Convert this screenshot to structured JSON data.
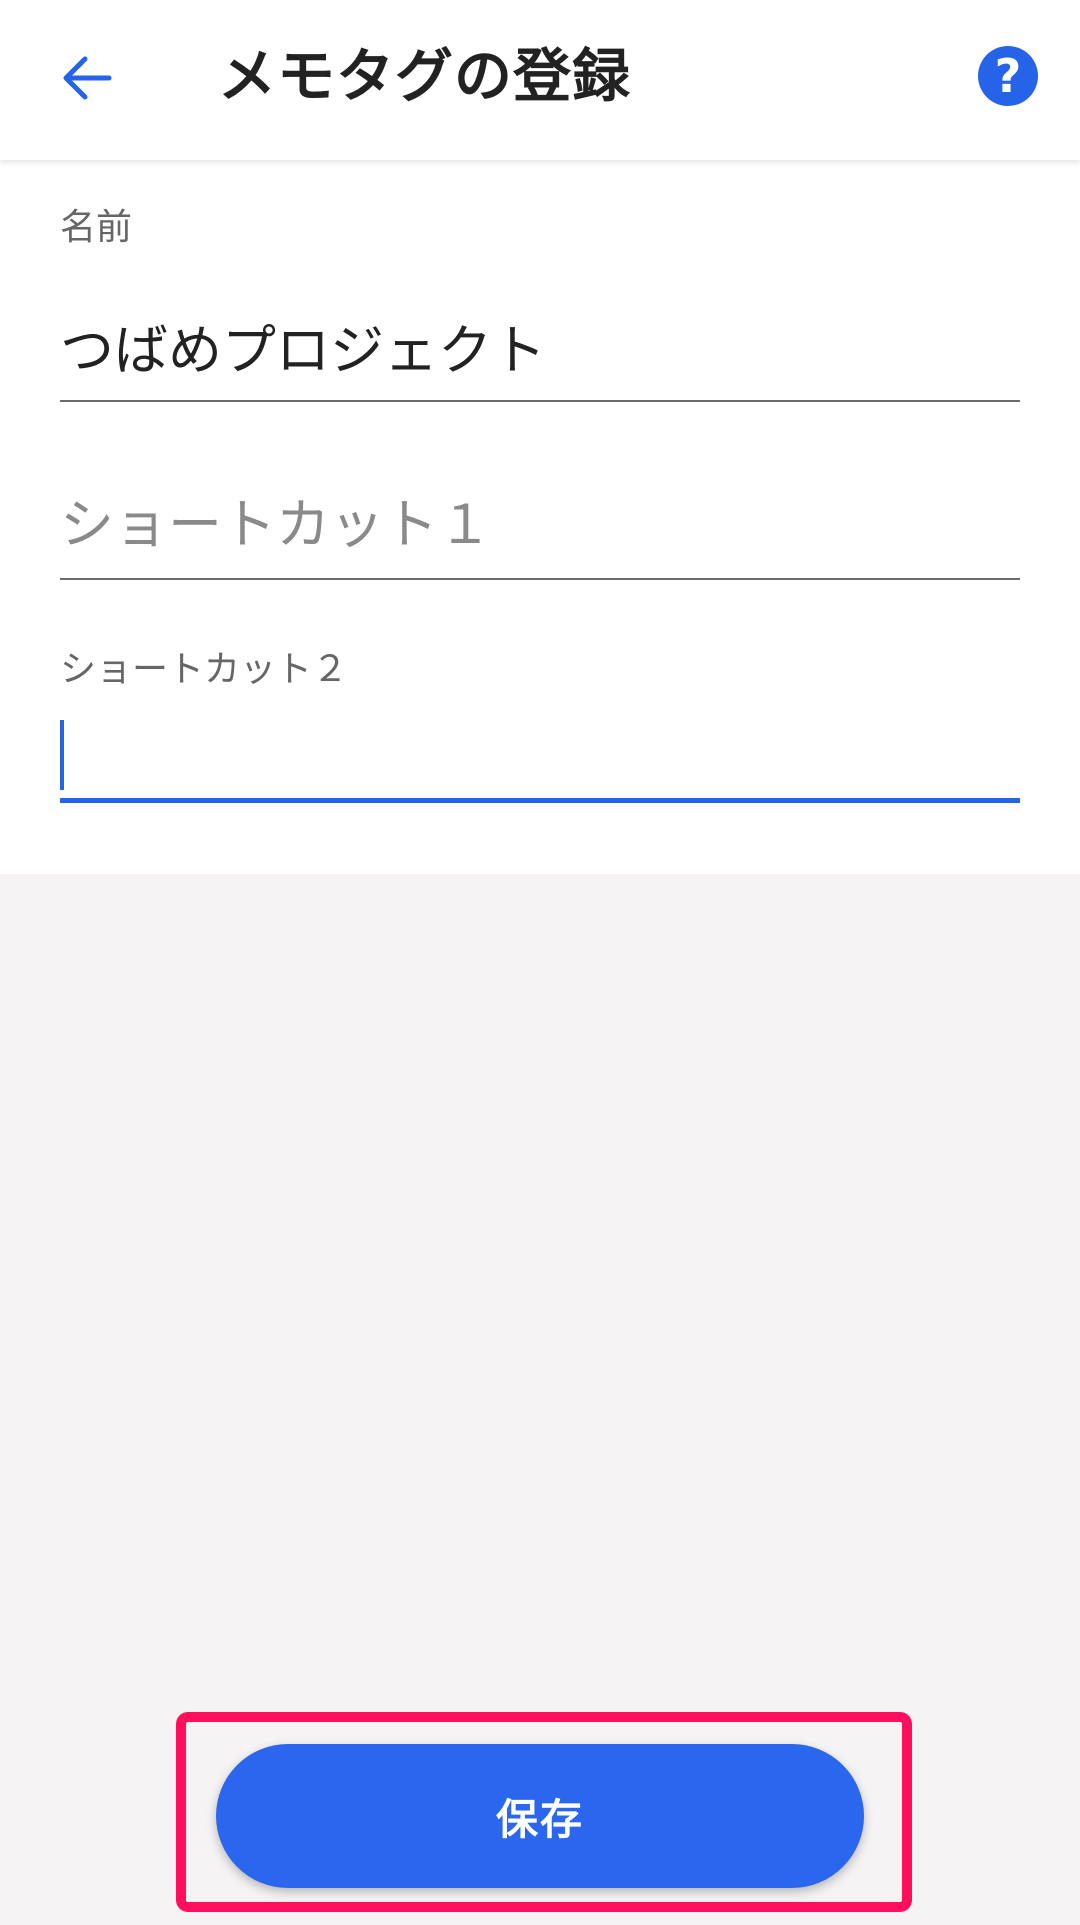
{
  "header": {
    "title": "メモタグの登録",
    "back_icon": "arrow-left-icon",
    "help_icon": "help-icon",
    "help_glyph": "?"
  },
  "form": {
    "name": {
      "label": "名前",
      "value": "つばめプロジェクト"
    },
    "shortcut1": {
      "placeholder": "ショートカット１"
    },
    "shortcut2": {
      "label": "ショートカット２",
      "value": ""
    }
  },
  "actions": {
    "save_label": "保存"
  },
  "colors": {
    "accent": "#2563e8",
    "save_button": "#2a66ee",
    "highlight": "#ff0f5e",
    "background": "#f5f3f4"
  }
}
